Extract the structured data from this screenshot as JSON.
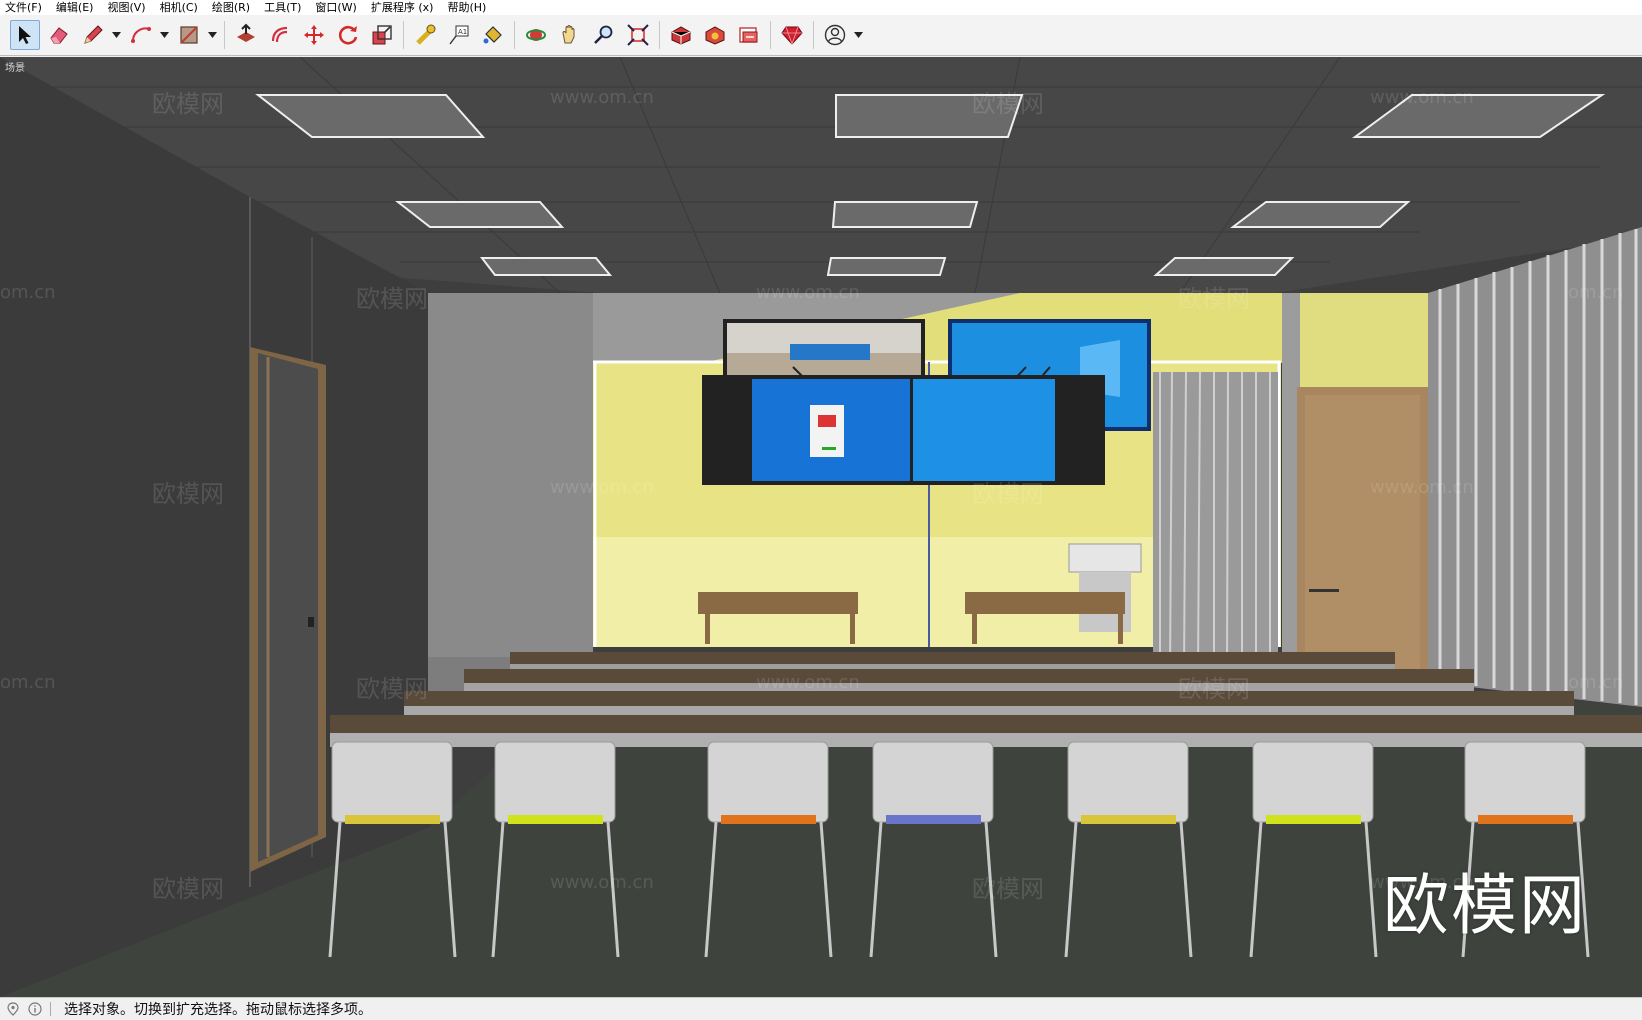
{
  "menu": [
    "文件(F)",
    "编辑(E)",
    "视图(V)",
    "相机(C)",
    "绘图(R)",
    "工具(T)",
    "窗口(W)",
    "扩展程序 (x)",
    "帮助(H)"
  ],
  "toolbar": {
    "groups": [
      [
        "select-tool",
        "eraser-tool",
        "pencil-line-tool",
        "arc-tool",
        "rectangle-tool"
      ],
      [
        "push-pull-tool",
        "offset-tool",
        "move-tool",
        "rotate-tool",
        "scale-tool"
      ],
      [
        "tape-measure-tool",
        "text-tool",
        "paint-bucket-tool"
      ],
      [
        "orbit-tool",
        "pan-tool",
        "zoom-tool",
        "zoom-extents-tool"
      ],
      [
        "3d-warehouse-button",
        "extension-warehouse-button",
        "layout-button"
      ],
      [
        "ruby-console-button"
      ],
      [
        "account-button"
      ]
    ],
    "active_tool": "select-tool"
  },
  "scene": {
    "tab_label": "场景",
    "colors": {
      "wall_dark": "#3d3d3d",
      "ceiling": "#4a4a4a",
      "back_wall_yellow": "#e6e38a",
      "screen_blue": "#1e88e5",
      "desk_wood": "#5a4a3a",
      "floor": "#3f443f",
      "chair_grey": "#d5d5d5",
      "door_wood": "#a88760"
    }
  },
  "watermarks": {
    "brand": "欧模网",
    "url": "www.om.cn",
    "url_partial": "om.cn",
    "logo": "欧模网"
  },
  "status": {
    "text": "选择对象。切换到扩充选择。拖动鼠标选择多项。"
  }
}
